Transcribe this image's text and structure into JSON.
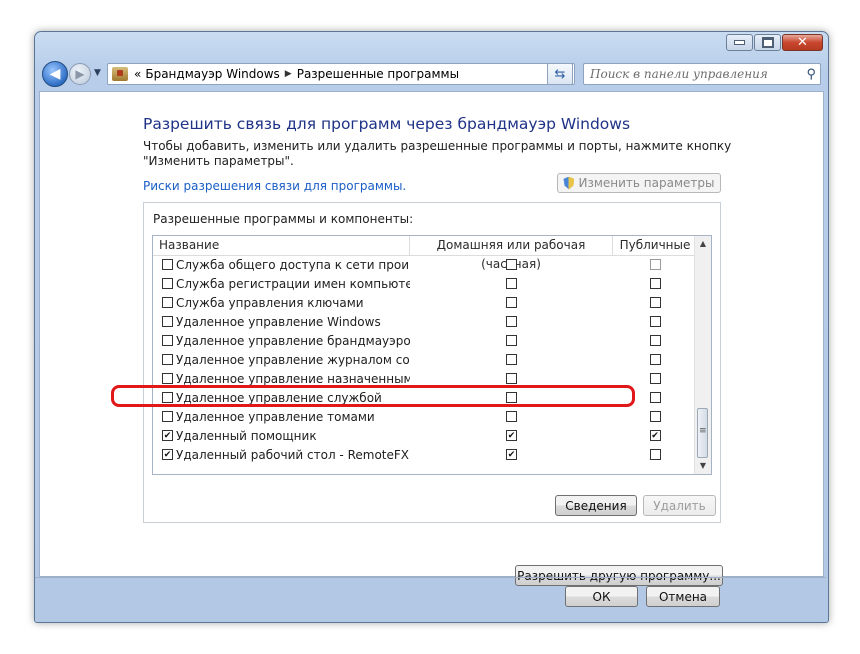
{
  "addressbar": {
    "prefix": "«",
    "crumb1": "Брандмауэр Windows",
    "crumb2": "Разрешенные программы"
  },
  "search": {
    "placeholder": "Поиск в панели управления"
  },
  "heading": "Разрешить связь для программ через брандмауэр Windows",
  "description": "Чтобы добавить, изменить или удалить разрешенные программы и порты, нажмите кнопку \"Изменить параметры\".",
  "risk_link": "Риски разрешения связи для программы.",
  "change_settings_label": "Изменить параметры",
  "group_label": "Разрешенные программы и компоненты:",
  "columns": {
    "name": "Название",
    "home": "Домашняя или рабочая (частная)",
    "public": "Публичные"
  },
  "rows": [
    {
      "name": "Служба общего доступа к сети проигры...",
      "enabled": false,
      "home": false,
      "public": false,
      "public_disabled": true
    },
    {
      "name": "Служба регистрации имен компьютеро...",
      "enabled": false,
      "home": false,
      "public": false
    },
    {
      "name": "Служба управления ключами",
      "enabled": false,
      "home": false,
      "public": false
    },
    {
      "name": "Удаленное управление Windows",
      "enabled": false,
      "home": false,
      "public": false
    },
    {
      "name": "Удаленное управление брандмауэром ...",
      "enabled": false,
      "home": false,
      "public": false
    },
    {
      "name": "Удаленное управление журналом собы...",
      "enabled": false,
      "home": false,
      "public": false
    },
    {
      "name": "Удаленное управление назначенными з...",
      "enabled": false,
      "home": false,
      "public": false
    },
    {
      "name": "Удаленное управление службой",
      "enabled": false,
      "home": false,
      "public": false
    },
    {
      "name": "Удаленное управление томами",
      "enabled": false,
      "home": false,
      "public": false
    },
    {
      "name": "Удаленный помощник",
      "enabled": true,
      "home": true,
      "public": true
    },
    {
      "name": "Удаленный рабочий стол - RemoteFX",
      "enabled": true,
      "home": true,
      "public": false
    }
  ],
  "details_label": "Сведения",
  "remove_label": "Удалить",
  "allow_other_label": "Разрешить другую программу...",
  "ok_label": "ОК",
  "cancel_label": "Отмена",
  "colors": {
    "heading": "#1e3287",
    "link": "#1a5ec6",
    "highlight": "#e01818"
  }
}
